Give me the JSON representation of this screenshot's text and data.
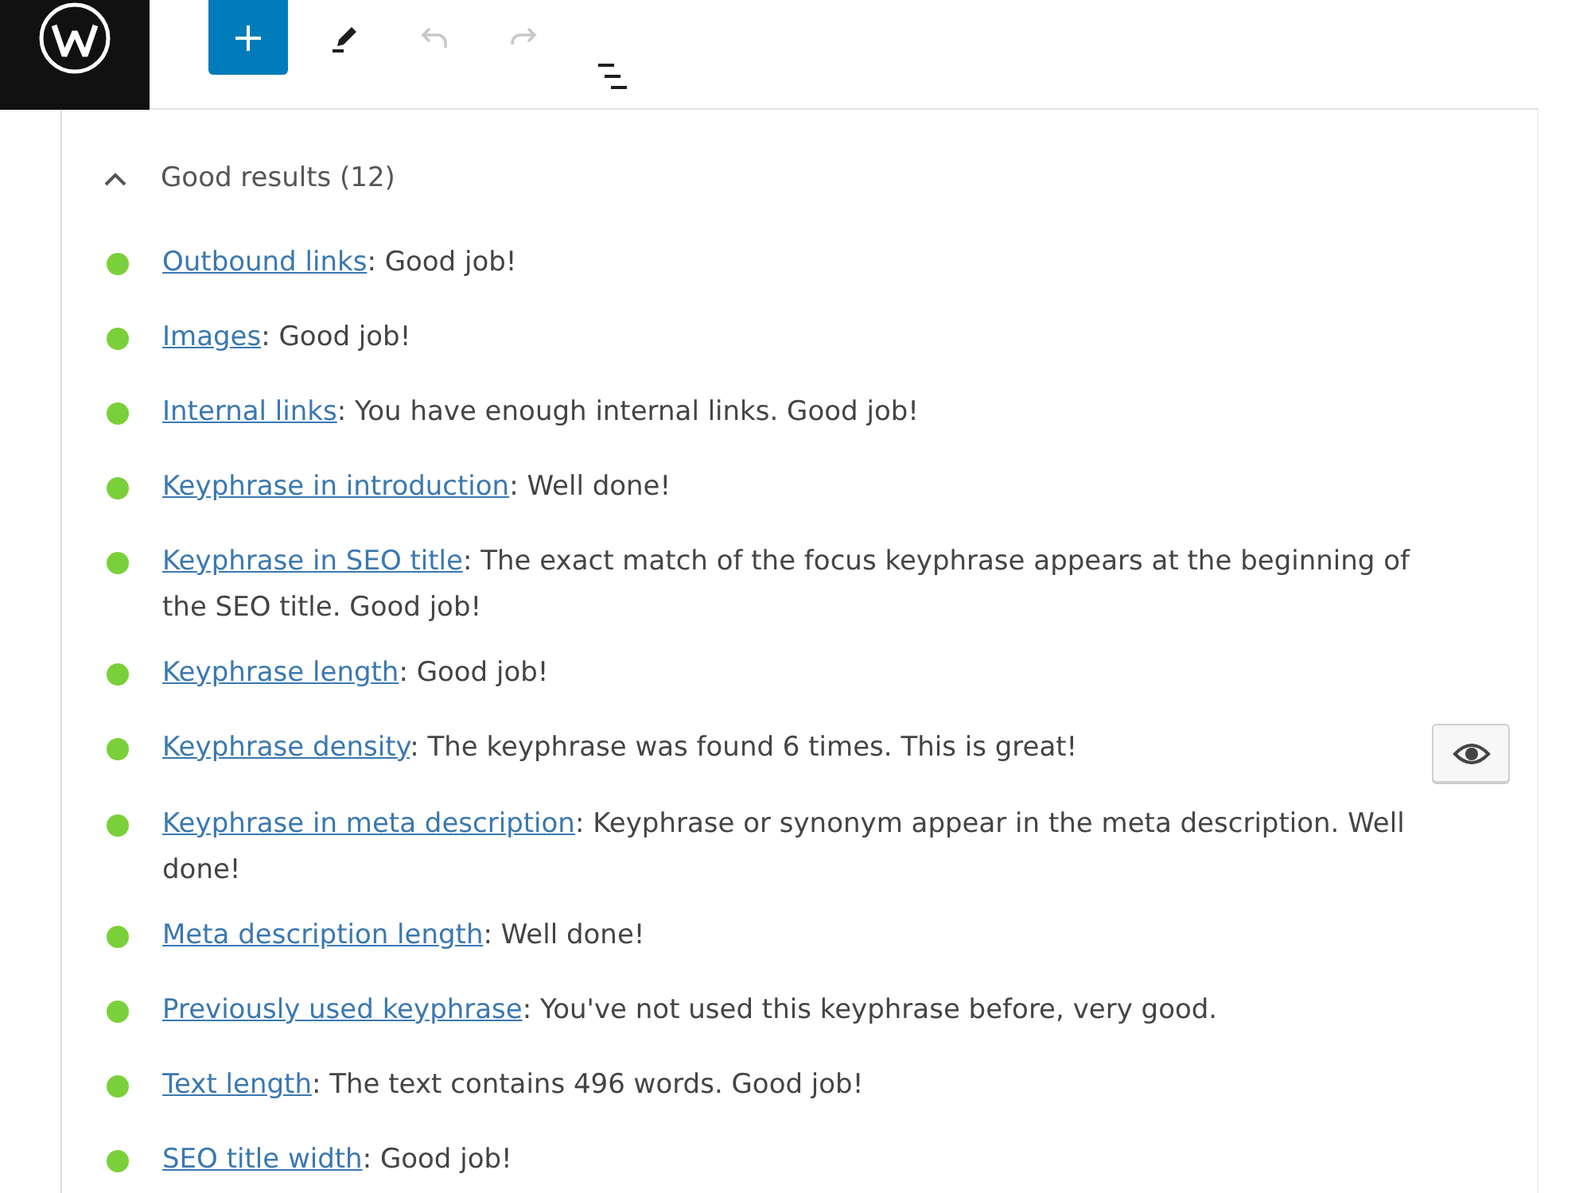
{
  "toolbar": [
    {
      "kind": "add",
      "disabled": false
    },
    {
      "kind": "edit",
      "disabled": false
    },
    {
      "kind": "undo",
      "disabled": true
    },
    {
      "kind": "redo",
      "disabled": true
    },
    {
      "kind": "list",
      "disabled": false
    }
  ],
  "section": {
    "title": "Good results (12)",
    "expanded": true,
    "results": [
      {
        "link": "Outbound links",
        "text": ": Good job!",
        "color": "#7ad03a",
        "marks_button": false
      },
      {
        "link": "Images",
        "text": ": Good job!",
        "color": "#7ad03a",
        "marks_button": false
      },
      {
        "link": "Internal links",
        "text": ": You have enough internal links. Good job!",
        "color": "#7ad03a",
        "marks_button": false
      },
      {
        "link": "Keyphrase in introduction",
        "text": ": Well done!",
        "color": "#7ad03a",
        "marks_button": false
      },
      {
        "link": "Keyphrase in SEO title",
        "text": ": The exact match of the focus keyphrase appears at the beginning of the SEO title. Good job!",
        "color": "#7ad03a",
        "marks_button": false
      },
      {
        "link": "Keyphrase length",
        "text": ": Good job!",
        "color": "#7ad03a",
        "marks_button": false
      },
      {
        "link": "Keyphrase density",
        "text": ": The keyphrase was found 6 times. This is great!",
        "color": "#7ad03a",
        "marks_button": true
      },
      {
        "link": "Keyphrase in meta description",
        "text": ": Keyphrase or synonym appear in the meta description. Well done!",
        "color": "#7ad03a",
        "marks_button": false
      },
      {
        "link": "Meta description length",
        "text": ": Well done!",
        "color": "#7ad03a",
        "marks_button": false
      },
      {
        "link": "Previously used keyphrase",
        "text": ": You've not used this keyphrase before, very good.",
        "color": "#7ad03a",
        "marks_button": false
      },
      {
        "link": "Text length",
        "text": ": The text contains 496 words. Good job!",
        "color": "#7ad03a",
        "marks_button": false
      },
      {
        "link": "SEO title width",
        "text": ": Good job!",
        "color": "#7ad03a",
        "marks_button": false
      }
    ]
  }
}
